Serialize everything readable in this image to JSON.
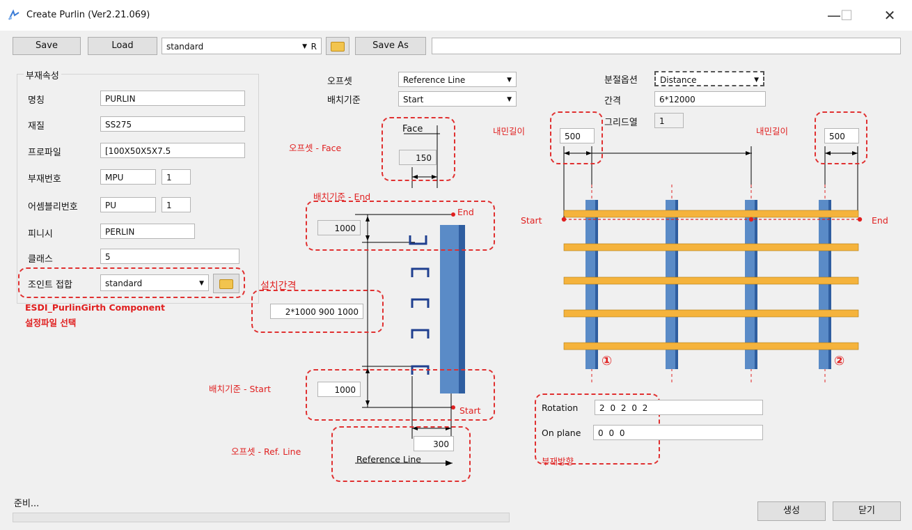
{
  "window": {
    "title": "Create Purlin (Ver2.21.069)",
    "controls": [
      "—",
      "☐",
      "✕"
    ]
  },
  "toolbar": {
    "save": "Save",
    "load": "Load",
    "preset": "standard",
    "preset_suffix": "R",
    "save_as": "Save As",
    "save_as_name": ""
  },
  "props": {
    "group_title": "부재속성",
    "name_label": "명칭",
    "name_value": "PURLIN",
    "material_label": "재질",
    "material_value": "SS275",
    "profile_label": "프로파일",
    "profile_value": "[100X50X5X7.5",
    "part_no_label": "부재번호",
    "part_prefix": "MPU",
    "part_start": "1",
    "assembly_no_label": "어셈블리번호",
    "assembly_prefix": "PU",
    "assembly_start": "1",
    "finish_label": "피니시",
    "finish_value": "PERLIN",
    "class_label": "클래스",
    "class_value": "5",
    "joint_label": "조인트 접합",
    "joint_value": "standard"
  },
  "placement": {
    "offset_label": "오프셋",
    "offset_value": "Reference Line",
    "basis_label": "배치기준",
    "basis_value": "Start",
    "face_title": "Face",
    "face_offset": "150",
    "end_value": "1000",
    "spacing_value": "2*1000 900 1000",
    "start_value": "1000",
    "ref_offset": "300",
    "ref_line_title": "Reference Line",
    "end_marker": "End",
    "start_marker": "Start"
  },
  "split": {
    "option_label": "분절옵션",
    "option_value": "Distance",
    "interval_label": "간격",
    "interval_value": "6*12000",
    "grid_label": "그리드열",
    "grid_value": "1",
    "inner_left": "500",
    "inner_right": "500",
    "start_marker": "Start",
    "end_marker": "End",
    "grid_num_1": "①",
    "grid_num_2": "②"
  },
  "direction": {
    "rotation_label": "Rotation",
    "rotation_value": "2 0 2 0 2",
    "onplane_label": "On plane",
    "onplane_value": "0 0 0"
  },
  "annotations": {
    "offset_face": "오프셋 - Face",
    "basis_end": "배치기준 - End",
    "spacing": "설치간격",
    "basis_start": "배치기준 - Start",
    "offset_ref": "오프셋 - Ref. Line",
    "component_line1": "ESDI_PurlinGirth Component",
    "component_line2": "설정파일 선택",
    "inner_length_left": "내민길이",
    "inner_length_right": "내민길이",
    "member_direction": "부재방향"
  },
  "status": {
    "text": "준비...",
    "progress": 0,
    "create": "생성",
    "close": "닫기"
  },
  "colors": {
    "purlin": "#f5b33c",
    "column": "#4a7ab8",
    "annotation": "#e02020"
  }
}
